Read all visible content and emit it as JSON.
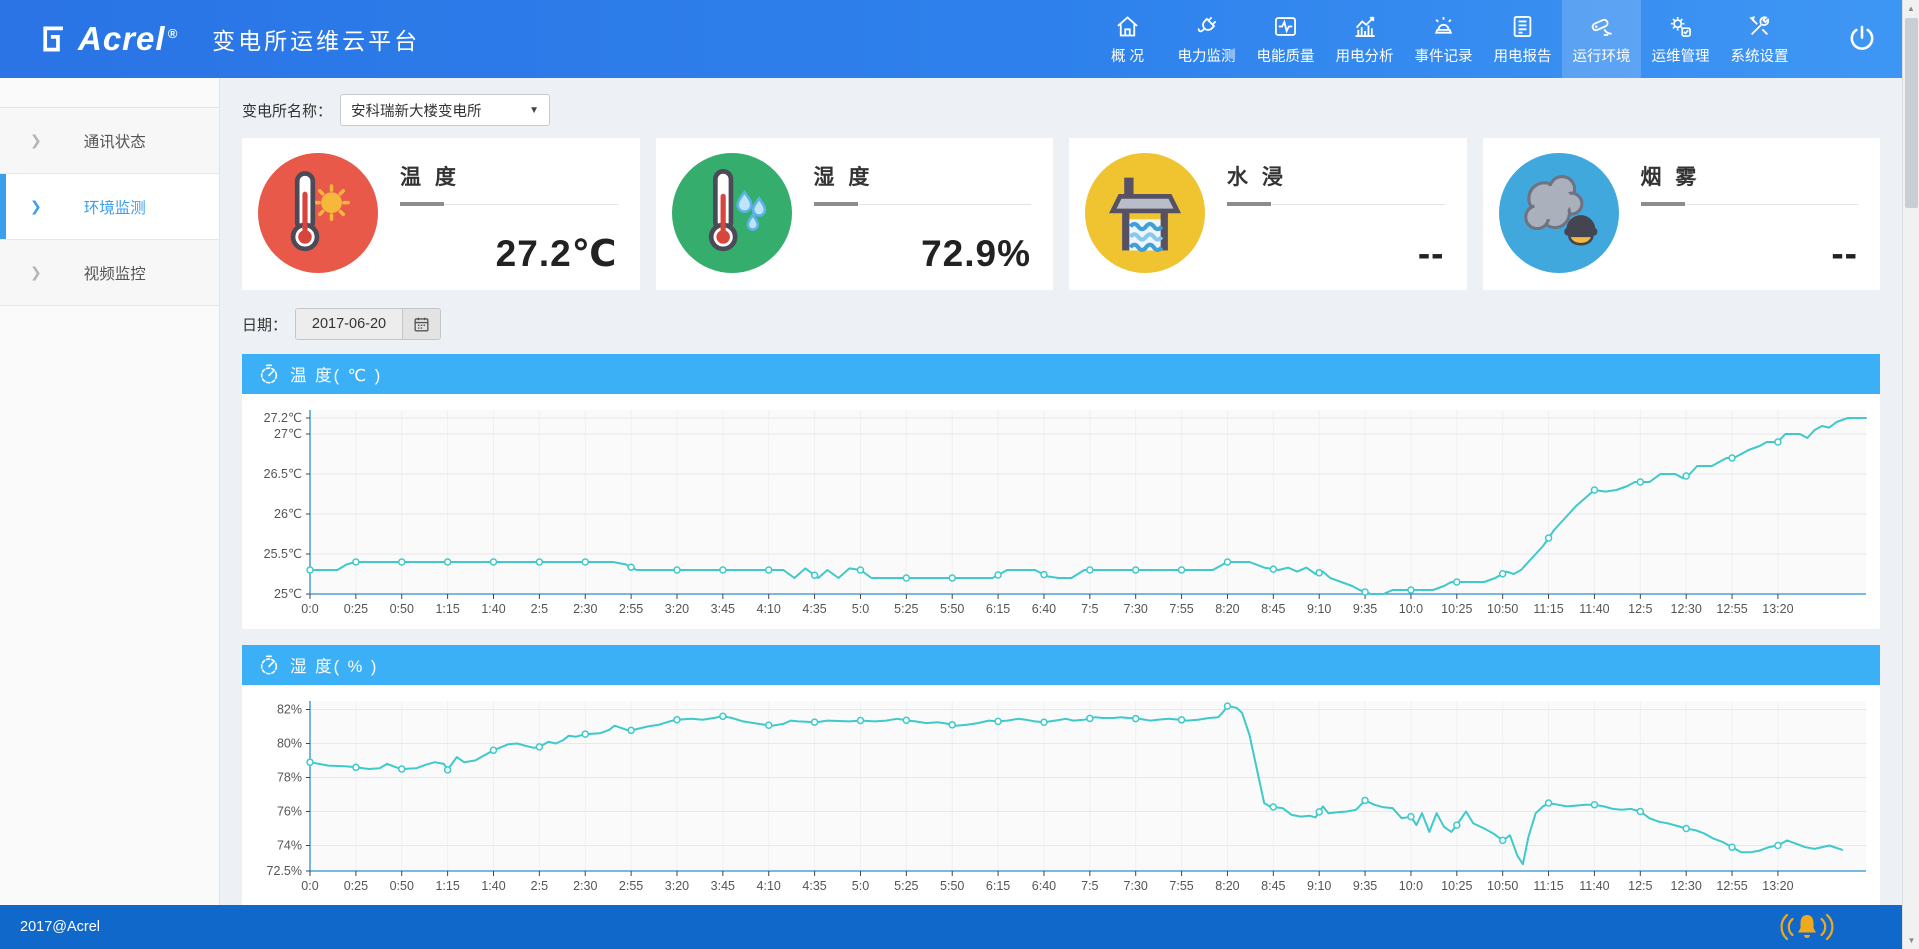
{
  "header": {
    "logo_text": "Acrel",
    "logo_reg": "®",
    "app_title": "变电所运维云平台",
    "nav": [
      {
        "label": "概 况",
        "icon": "home-icon"
      },
      {
        "label": "电力监测",
        "icon": "plug-icon"
      },
      {
        "label": "电能质量",
        "icon": "pulse-icon"
      },
      {
        "label": "用电分析",
        "icon": "analysis-icon"
      },
      {
        "label": "事件记录",
        "icon": "alarm-icon"
      },
      {
        "label": "用电报告",
        "icon": "report-icon"
      },
      {
        "label": "运行环境",
        "icon": "camera-icon",
        "active": true
      },
      {
        "label": "运维管理",
        "icon": "gear-icon"
      },
      {
        "label": "系统设置",
        "icon": "tools-icon"
      }
    ]
  },
  "sidebar": {
    "items": [
      {
        "label": "通讯状态",
        "active": false
      },
      {
        "label": "环境监测",
        "active": true
      },
      {
        "label": "视频监控",
        "active": false
      }
    ]
  },
  "toolbar": {
    "station_label": "变电所名称：",
    "station_value": "安科瑞新大楼变电所"
  },
  "cards": [
    {
      "title": "温 度",
      "value": "27.2℃",
      "icon": "thermometer-sun-icon",
      "circle_color": "#e8594a"
    },
    {
      "title": "湿 度",
      "value": "72.9%",
      "icon": "thermometer-drops-icon",
      "circle_color": "#35ad6d"
    },
    {
      "title": "水 浸",
      "value": "--",
      "icon": "water-tank-icon",
      "circle_color": "#f0c330"
    },
    {
      "title": "烟 雾",
      "value": "--",
      "icon": "smoke-icon",
      "circle_color": "#41a8dd"
    }
  ],
  "date_bar": {
    "label": "日期：",
    "value": "2017-06-20"
  },
  "chart_data": [
    {
      "type": "line",
      "title": "温 度( ℃ )",
      "unit": "℃",
      "line_color": "#3ec9cb",
      "yrange": [
        25,
        27.3
      ],
      "yticks": [
        25,
        25.5,
        26,
        26.5,
        27,
        27.2
      ],
      "ytick_labels": [
        "25℃",
        "25.5℃",
        "26℃",
        "26.5℃",
        "27℃",
        "27.2℃"
      ],
      "xmax_minutes": 848,
      "xticks": [
        0,
        25,
        50,
        75,
        100,
        125,
        150,
        175,
        200,
        225,
        250,
        275,
        300,
        325,
        350,
        375,
        400,
        425,
        450,
        475,
        500,
        525,
        550,
        575,
        600,
        625,
        650,
        675,
        700,
        725,
        750,
        775,
        800
      ],
      "xtick_labels": [
        "0:0",
        "0:25",
        "0:50",
        "1:15",
        "1:40",
        "2:5",
        "2:30",
        "2:55",
        "3:20",
        "3:45",
        "4:10",
        "4:35",
        "5:0",
        "5:25",
        "5:50",
        "6:15",
        "6:40",
        "7:5",
        "7:30",
        "7:55",
        "8:20",
        "8:45",
        "9:10",
        "9:35",
        "10:0",
        "10:25",
        "10:50",
        "11:15",
        "11:40",
        "12:5",
        "12:30",
        "12:55",
        "13:20"
      ],
      "points": [
        [
          0,
          25.3
        ],
        [
          15,
          25.3
        ],
        [
          20,
          25.37
        ],
        [
          25,
          25.4
        ],
        [
          165,
          25.4
        ],
        [
          172,
          25.37
        ],
        [
          178,
          25.3
        ],
        [
          258,
          25.3
        ],
        [
          264,
          25.2
        ],
        [
          270,
          25.32
        ],
        [
          277,
          25.2
        ],
        [
          282,
          25.3
        ],
        [
          288,
          25.2
        ],
        [
          294,
          25.32
        ],
        [
          300,
          25.3
        ],
        [
          306,
          25.2
        ],
        [
          372,
          25.2
        ],
        [
          380,
          25.3
        ],
        [
          395,
          25.3
        ],
        [
          402,
          25.22
        ],
        [
          408,
          25.2
        ],
        [
          415,
          25.2
        ],
        [
          422,
          25.3
        ],
        [
          492,
          25.3
        ],
        [
          500,
          25.4
        ],
        [
          512,
          25.4
        ],
        [
          520,
          25.33
        ],
        [
          528,
          25.3
        ],
        [
          533,
          25.33
        ],
        [
          538,
          25.28
        ],
        [
          543,
          25.33
        ],
        [
          548,
          25.25
        ],
        [
          552,
          25.28
        ],
        [
          556,
          25.2
        ],
        [
          562,
          25.15
        ],
        [
          568,
          25.1
        ],
        [
          572,
          25.05
        ],
        [
          578,
          25.0
        ],
        [
          585,
          25.0
        ],
        [
          590,
          25.05
        ],
        [
          612,
          25.05
        ],
        [
          618,
          25.1
        ],
        [
          622,
          25.15
        ],
        [
          640,
          25.15
        ],
        [
          646,
          25.2
        ],
        [
          652,
          25.28
        ],
        [
          656,
          25.25
        ],
        [
          660,
          25.3
        ],
        [
          666,
          25.45
        ],
        [
          672,
          25.6
        ],
        [
          678,
          25.8
        ],
        [
          684,
          25.95
        ],
        [
          690,
          26.1
        ],
        [
          695,
          26.2
        ],
        [
          700,
          26.3
        ],
        [
          706,
          26.28
        ],
        [
          712,
          26.3
        ],
        [
          718,
          26.35
        ],
        [
          722,
          26.4
        ],
        [
          730,
          26.4
        ],
        [
          736,
          26.5
        ],
        [
          744,
          26.5
        ],
        [
          748,
          26.45
        ],
        [
          752,
          26.5
        ],
        [
          756,
          26.6
        ],
        [
          764,
          26.6
        ],
        [
          768,
          26.65
        ],
        [
          772,
          26.7
        ],
        [
          776,
          26.7
        ],
        [
          780,
          26.75
        ],
        [
          784,
          26.8
        ],
        [
          790,
          26.85
        ],
        [
          794,
          26.9
        ],
        [
          800,
          26.9
        ],
        [
          804,
          27.0
        ],
        [
          812,
          27.0
        ],
        [
          816,
          26.95
        ],
        [
          820,
          27.05
        ],
        [
          824,
          27.1
        ],
        [
          828,
          27.08
        ],
        [
          832,
          27.15
        ],
        [
          838,
          27.2
        ],
        [
          848,
          27.2
        ]
      ]
    },
    {
      "type": "line",
      "title": "湿 度( % )",
      "unit": "%",
      "line_color": "#3ec9cb",
      "yrange": [
        72.5,
        82.5
      ],
      "yticks": [
        72.5,
        74,
        76,
        78,
        80,
        82
      ],
      "ytick_labels": [
        "72.5%",
        "74%",
        "76%",
        "78%",
        "80%",
        "82%"
      ],
      "xmax_minutes": 848,
      "xticks": [
        0,
        25,
        50,
        75,
        100,
        125,
        150,
        175,
        200,
        225,
        250,
        275,
        300,
        325,
        350,
        375,
        400,
        425,
        450,
        475,
        500,
        525,
        550,
        575,
        600,
        625,
        650,
        675,
        700,
        725,
        750,
        775,
        800
      ],
      "xtick_labels": [
        "0:0",
        "0:25",
        "0:50",
        "1:15",
        "1:40",
        "2:5",
        "2:30",
        "2:55",
        "3:20",
        "3:45",
        "4:10",
        "4:35",
        "5:0",
        "5:25",
        "5:50",
        "6:15",
        "6:40",
        "7:5",
        "7:30",
        "7:55",
        "8:20",
        "8:45",
        "9:10",
        "9:35",
        "10:0",
        "10:25",
        "10:50",
        "11:15",
        "11:40",
        "12:5",
        "12:30",
        "12:55",
        "13:20"
      ],
      "points": [
        [
          0,
          78.9
        ],
        [
          10,
          78.7
        ],
        [
          20,
          78.65
        ],
        [
          25,
          78.6
        ],
        [
          32,
          78.5
        ],
        [
          38,
          78.55
        ],
        [
          42,
          78.8
        ],
        [
          47,
          78.6
        ],
        [
          50,
          78.5
        ],
        [
          58,
          78.55
        ],
        [
          63,
          78.75
        ],
        [
          68,
          78.9
        ],
        [
          73,
          78.8
        ],
        [
          75,
          78.45
        ],
        [
          80,
          79.2
        ],
        [
          84,
          78.9
        ],
        [
          90,
          79.0
        ],
        [
          95,
          79.3
        ],
        [
          100,
          79.6
        ],
        [
          108,
          79.95
        ],
        [
          113,
          80.0
        ],
        [
          118,
          79.85
        ],
        [
          122,
          79.75
        ],
        [
          125,
          79.8
        ],
        [
          130,
          80.1
        ],
        [
          134,
          80.0
        ],
        [
          138,
          80.2
        ],
        [
          141,
          80.45
        ],
        [
          145,
          80.4
        ],
        [
          150,
          80.55
        ],
        [
          158,
          80.6
        ],
        [
          163,
          80.8
        ],
        [
          166,
          81.05
        ],
        [
          170,
          80.9
        ],
        [
          174,
          80.75
        ],
        [
          178,
          80.85
        ],
        [
          184,
          81.0
        ],
        [
          190,
          81.1
        ],
        [
          196,
          81.3
        ],
        [
          200,
          81.4
        ],
        [
          208,
          81.45
        ],
        [
          214,
          81.4
        ],
        [
          220,
          81.5
        ],
        [
          225,
          81.6
        ],
        [
          230,
          81.5
        ],
        [
          236,
          81.3
        ],
        [
          242,
          81.2
        ],
        [
          248,
          81.1
        ],
        [
          252,
          81.05
        ],
        [
          258,
          81.15
        ],
        [
          262,
          81.35
        ],
        [
          266,
          81.3
        ],
        [
          276,
          81.25
        ],
        [
          282,
          81.35
        ],
        [
          294,
          81.3
        ],
        [
          300,
          81.35
        ],
        [
          308,
          81.3
        ],
        [
          314,
          81.35
        ],
        [
          320,
          81.45
        ],
        [
          326,
          81.35
        ],
        [
          330,
          81.3
        ],
        [
          336,
          81.2
        ],
        [
          342,
          81.25
        ],
        [
          348,
          81.15
        ],
        [
          352,
          81.05
        ],
        [
          358,
          81.1
        ],
        [
          364,
          81.2
        ],
        [
          370,
          81.35
        ],
        [
          375,
          81.3
        ],
        [
          380,
          81.35
        ],
        [
          386,
          81.45
        ],
        [
          390,
          81.4
        ],
        [
          395,
          81.3
        ],
        [
          400,
          81.25
        ],
        [
          406,
          81.35
        ],
        [
          412,
          81.45
        ],
        [
          416,
          81.35
        ],
        [
          422,
          81.4
        ],
        [
          428,
          81.55
        ],
        [
          432,
          81.5
        ],
        [
          438,
          81.5
        ],
        [
          442,
          81.55
        ],
        [
          446,
          81.5
        ],
        [
          452,
          81.45
        ],
        [
          458,
          81.35
        ],
        [
          462,
          81.4
        ],
        [
          468,
          81.45
        ],
        [
          474,
          81.4
        ],
        [
          478,
          81.35
        ],
        [
          484,
          81.4
        ],
        [
          490,
          81.5
        ],
        [
          495,
          81.55
        ],
        [
          498,
          81.9
        ],
        [
          500,
          82.2
        ],
        [
          505,
          82.1
        ],
        [
          508,
          81.8
        ],
        [
          512,
          80.5
        ],
        [
          515,
          79.0
        ],
        [
          518,
          77.5
        ],
        [
          520,
          76.5
        ],
        [
          523,
          76.3
        ],
        [
          526,
          76.25
        ],
        [
          530,
          76.2
        ],
        [
          535,
          75.8
        ],
        [
          540,
          75.7
        ],
        [
          545,
          75.75
        ],
        [
          548,
          75.65
        ],
        [
          552,
          76.3
        ],
        [
          555,
          75.9
        ],
        [
          560,
          75.95
        ],
        [
          565,
          76.0
        ],
        [
          570,
          76.1
        ],
        [
          575,
          76.65
        ],
        [
          580,
          76.4
        ],
        [
          585,
          76.25
        ],
        [
          590,
          76.2
        ],
        [
          595,
          75.6
        ],
        [
          600,
          75.7
        ],
        [
          603,
          75.2
        ],
        [
          606,
          75.9
        ],
        [
          610,
          74.8
        ],
        [
          614,
          75.9
        ],
        [
          618,
          75.1
        ],
        [
          622,
          74.8
        ],
        [
          625,
          75.2
        ],
        [
          630,
          76.0
        ],
        [
          634,
          75.3
        ],
        [
          640,
          75.0
        ],
        [
          645,
          74.7
        ],
        [
          650,
          74.3
        ],
        [
          654,
          74.6
        ],
        [
          658,
          73.4
        ],
        [
          661,
          72.9
        ],
        [
          664,
          74.5
        ],
        [
          668,
          75.9
        ],
        [
          672,
          76.3
        ],
        [
          675,
          76.5
        ],
        [
          680,
          76.4
        ],
        [
          685,
          76.3
        ],
        [
          690,
          76.35
        ],
        [
          695,
          76.4
        ],
        [
          700,
          76.4
        ],
        [
          705,
          76.3
        ],
        [
          710,
          76.15
        ],
        [
          715,
          76.1
        ],
        [
          720,
          76.15
        ],
        [
          725,
          76.0
        ],
        [
          730,
          75.6
        ],
        [
          735,
          75.4
        ],
        [
          740,
          75.3
        ],
        [
          745,
          75.15
        ],
        [
          750,
          75.0
        ],
        [
          755,
          74.9
        ],
        [
          760,
          74.7
        ],
        [
          765,
          74.4
        ],
        [
          770,
          74.2
        ],
        [
          775,
          73.9
        ],
        [
          780,
          73.6
        ],
        [
          785,
          73.6
        ],
        [
          790,
          73.7
        ],
        [
          795,
          73.9
        ],
        [
          800,
          74.0
        ],
        [
          805,
          74.3
        ],
        [
          810,
          74.1
        ],
        [
          815,
          73.9
        ],
        [
          820,
          73.8
        ],
        [
          828,
          74.0
        ],
        [
          835,
          73.75
        ]
      ]
    }
  ],
  "footer": {
    "copyright": "2017@Acrel"
  },
  "colors": {
    "header_blue": "#2a74e6",
    "panel_header_blue": "#3cb0f7",
    "line_teal": "#3ec9cb",
    "footer_blue": "#1168cb",
    "accent_blue": "#3b9ff0",
    "card_red": "#e8594a",
    "card_green": "#35ad6d",
    "card_yellow": "#f0c330",
    "card_blue": "#41a8dd"
  }
}
